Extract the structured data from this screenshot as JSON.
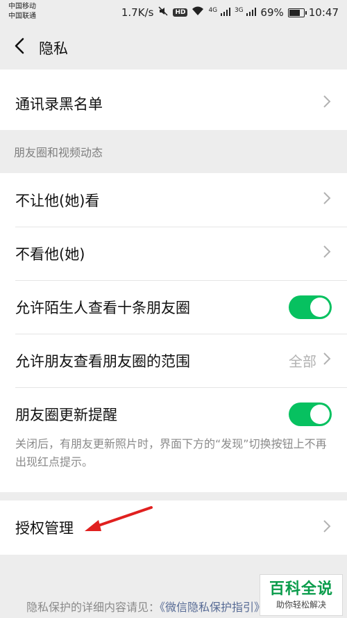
{
  "status": {
    "carrier1": "中国移动",
    "carrier2": "中国联通",
    "speed": "1.7K/s",
    "hd": "HD",
    "sig1": "4G",
    "sig2": "3G",
    "battery": "69%",
    "battery_level": 0.69,
    "time": "10:47"
  },
  "nav": {
    "title": "隐私"
  },
  "rows": {
    "blacklist": "通讯录黑名单",
    "moments_header": "朋友圈和视频动态",
    "hide_from": "不让他(她)看",
    "not_see": "不看他(她)",
    "stranger_view": "允许陌生人查看十条朋友圈",
    "friend_range": "允许朋友查看朋友圈的范围",
    "friend_range_value": "全部",
    "update_remind": "朋友圈更新提醒",
    "update_desc": "关闭后，有朋友更新照片时，界面下方的“发现”切换按钮上不再出现红点提示。",
    "auth": "授权管理"
  },
  "footer": {
    "prefix": "隐私保护的详细内容请见：",
    "link": "《微信隐私保护指引》"
  },
  "watermark": {
    "title": "百科全说",
    "sub": "助你轻松解决"
  },
  "colors": {
    "accent": "#07c160",
    "link": "#576b95",
    "arrow": "#e0201f"
  }
}
